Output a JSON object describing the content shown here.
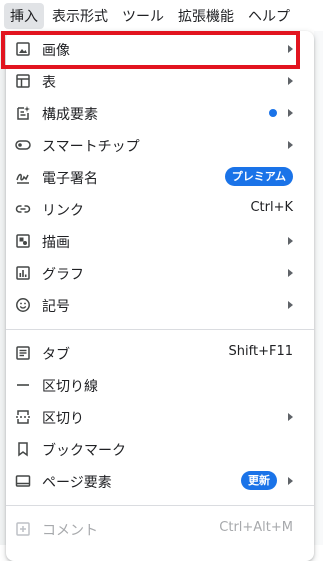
{
  "menubar": {
    "items": [
      {
        "label": "挿入"
      },
      {
        "label": "表示形式"
      },
      {
        "label": "ツール"
      },
      {
        "label": "拡張機能"
      },
      {
        "label": "ヘルプ"
      }
    ]
  },
  "menu": {
    "items": [
      {
        "label": "画像",
        "icon": "image-icon"
      },
      {
        "label": "表",
        "icon": "table-icon"
      },
      {
        "label": "構成要素",
        "icon": "building-blocks-icon"
      },
      {
        "label": "スマートチップ",
        "icon": "smart-chip-icon"
      },
      {
        "label": "電子署名",
        "icon": "esignature-icon",
        "badge": "プレミアム"
      },
      {
        "label": "リンク",
        "icon": "link-icon",
        "shortcut": "Ctrl+K"
      },
      {
        "label": "描画",
        "icon": "drawing-icon"
      },
      {
        "label": "グラフ",
        "icon": "chart-icon"
      },
      {
        "label": "記号",
        "icon": "emoji-icon"
      },
      {
        "label": "タブ",
        "icon": "tab-icon",
        "shortcut": "Shift+F11"
      },
      {
        "label": "区切り線",
        "icon": "horizontal-line-icon"
      },
      {
        "label": "区切り",
        "icon": "break-icon"
      },
      {
        "label": "ブックマーク",
        "icon": "bookmark-icon"
      },
      {
        "label": "ページ要素",
        "icon": "page-elements-icon",
        "badge": "更新"
      },
      {
        "label": "コメント",
        "icon": "add-comment-icon",
        "shortcut": "Ctrl+Alt+M"
      }
    ]
  },
  "colors": {
    "accent": "#1a73e8",
    "highlight_border": "#e2141f",
    "disabled_text": "#a7a9ac"
  }
}
